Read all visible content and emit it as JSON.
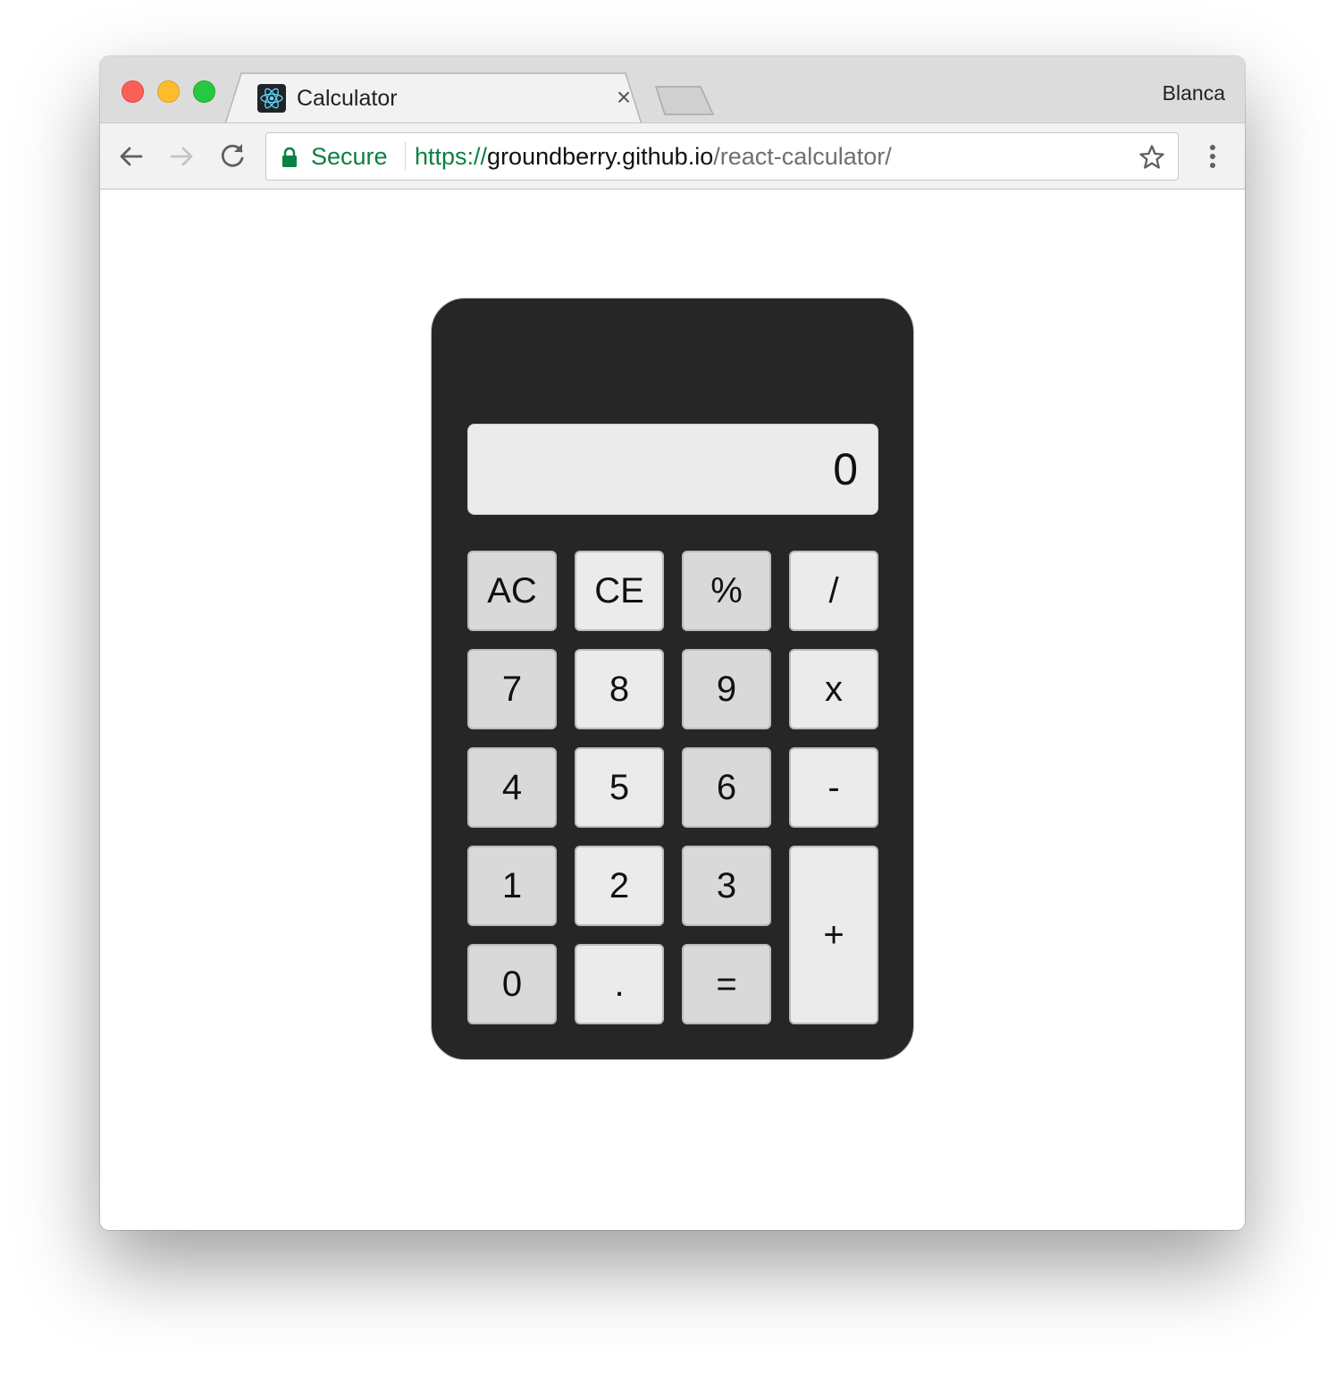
{
  "browser": {
    "tab": {
      "title": "Calculator",
      "close_glyph": "×",
      "favicon": "react-icon"
    },
    "profile_name": "Blanca",
    "toolbar": {
      "back_icon": "arrow-left-icon",
      "forward_icon": "arrow-right-icon",
      "reload_icon": "reload-icon",
      "menu_icon": "more-vert-icon"
    },
    "omnibox": {
      "secure_label": "Secure",
      "url_scheme": "https://",
      "url_host": "groundberry.github.io",
      "url_path": "/react-calculator/",
      "bookmark_icon": "star-icon"
    }
  },
  "calculator": {
    "display": "0",
    "keys": [
      "AC",
      "CE",
      "%",
      "/",
      "7",
      "8",
      "9",
      "x",
      "4",
      "5",
      "6",
      "-",
      "1",
      "2",
      "3",
      "+",
      "0",
      ".",
      "="
    ]
  },
  "colors": {
    "calculator_body": "#262626",
    "key_dark": "#d9d9d9",
    "key_light": "#ebebeb",
    "display_bg": "#ebebeb",
    "secure_green": "#0b8043"
  }
}
